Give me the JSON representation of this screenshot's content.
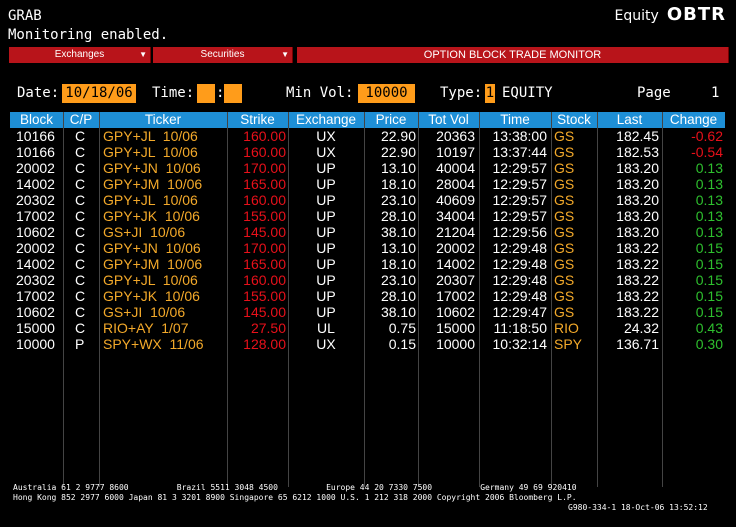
{
  "header": {
    "line1": "GRAB",
    "line2": "Monitoring enabled.",
    "market": "Equity",
    "function": "OBTR"
  },
  "toolbar": {
    "exchanges": "Exchanges",
    "securities": "Securities",
    "title": "OPTION BLOCK TRADE MONITOR"
  },
  "form": {
    "date_label": "Date:",
    "date_value": "10/18/06",
    "time_label": "Time:",
    "time_sep": ":",
    "time_h": "",
    "time_m": "",
    "minvol_label": "Min Vol:",
    "minvol_value": "10000",
    "type_label": "Type:",
    "type_value": "1",
    "type_text": "EQUITY",
    "page_label": "Page",
    "page_value": "1"
  },
  "columns": [
    "Block",
    "C/P",
    "Ticker",
    "Strike",
    "Exchange",
    "Price",
    "Tot Vol",
    "Time",
    "Stock",
    "Last",
    "Change"
  ],
  "rows": [
    [
      "10166",
      "C",
      "GPY+JL  10/06",
      "160.00",
      "UX",
      "22.90",
      "20363",
      "13:38:00",
      "GS",
      "182.45",
      "-0.62"
    ],
    [
      "10166",
      "C",
      "GPY+JL  10/06",
      "160.00",
      "UX",
      "22.90",
      "10197",
      "13:37:44",
      "GS",
      "182.53",
      "-0.54"
    ],
    [
      "20002",
      "C",
      "GPY+JN  10/06",
      "170.00",
      "UP",
      "13.10",
      "40004",
      "12:29:57",
      "GS",
      "183.20",
      "0.13"
    ],
    [
      "14002",
      "C",
      "GPY+JM  10/06",
      "165.00",
      "UP",
      "18.10",
      "28004",
      "12:29:57",
      "GS",
      "183.20",
      "0.13"
    ],
    [
      "20302",
      "C",
      "GPY+JL  10/06",
      "160.00",
      "UP",
      "23.10",
      "40609",
      "12:29:57",
      "GS",
      "183.20",
      "0.13"
    ],
    [
      "17002",
      "C",
      "GPY+JK  10/06",
      "155.00",
      "UP",
      "28.10",
      "34004",
      "12:29:57",
      "GS",
      "183.20",
      "0.13"
    ],
    [
      "10602",
      "C",
      "GS+JI  10/06",
      "145.00",
      "UP",
      "38.10",
      "21204",
      "12:29:56",
      "GS",
      "183.20",
      "0.13"
    ],
    [
      "20002",
      "C",
      "GPY+JN  10/06",
      "170.00",
      "UP",
      "13.10",
      "20002",
      "12:29:48",
      "GS",
      "183.22",
      "0.15"
    ],
    [
      "14002",
      "C",
      "GPY+JM  10/06",
      "165.00",
      "UP",
      "18.10",
      "14002",
      "12:29:48",
      "GS",
      "183.22",
      "0.15"
    ],
    [
      "20302",
      "C",
      "GPY+JL  10/06",
      "160.00",
      "UP",
      "23.10",
      "20307",
      "12:29:48",
      "GS",
      "183.22",
      "0.15"
    ],
    [
      "17002",
      "C",
      "GPY+JK  10/06",
      "155.00",
      "UP",
      "28.10",
      "17002",
      "12:29:48",
      "GS",
      "183.22",
      "0.15"
    ],
    [
      "10602",
      "C",
      "GS+JI  10/06",
      "145.00",
      "UP",
      "38.10",
      "10602",
      "12:29:47",
      "GS",
      "183.22",
      "0.15"
    ],
    [
      "15000",
      "C",
      "RIO+AY  1/07",
      "27.50",
      "UL",
      "0.75",
      "15000",
      "11:18:50",
      "RIO",
      "24.32",
      "0.43"
    ],
    [
      "10000",
      "P",
      "SPY+WX  11/06",
      "128.00",
      "UX",
      "0.15",
      "10000",
      "10:32:14",
      "SPY",
      "136.71",
      "0.30"
    ]
  ],
  "change_colors": {
    "negative": "#e8101a",
    "positive": "#2ec02e"
  },
  "footer": {
    "line1": "Australia 61 2 9777 8600          Brazil 5511 3048 4500          Europe 44 20 7330 7500          Germany 49 69 920410",
    "line2": "Hong Kong 852 2977 6000 Japan 81 3 3201 8900 Singapore 65 6212 1000 U.S. 1 212 318 2000 Copyright 2006 Bloomberg L.P.",
    "line3": "G980-334-1 18-Oct-06 13:52:12"
  }
}
